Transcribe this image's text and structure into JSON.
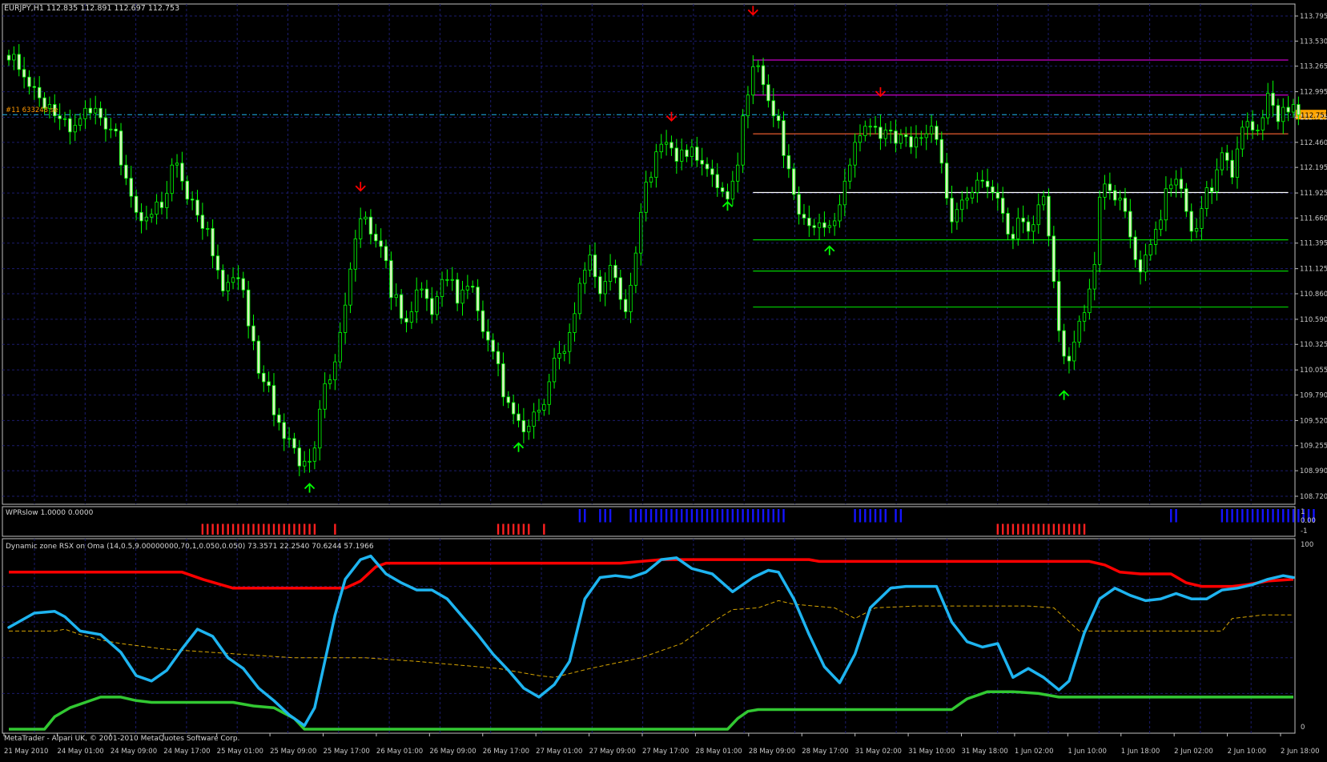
{
  "window": {
    "symbol_header": "EURJPY,H1  112.835 112.891 112.697 112.753",
    "order_label": "#11 633248 se",
    "footer": "MetaTrader - Alpari UK, © 2001-2010 MetaQuotes Software Corp."
  },
  "colors": {
    "background": "#000000",
    "grid": "#1c1c6e",
    "candle": "#00ff00",
    "candle_body_up": "#000000",
    "candle_body_down": "#d8f0c0",
    "price_tag_bg": "#ffa500",
    "signal_up": "#00ff00",
    "signal_down": "#ff0000",
    "rsx": "#1eb4f0",
    "upper_band": "#ff0000",
    "lower_band": "#32c832",
    "mid_band": "#d7a500",
    "wpr_up": "#1414ff",
    "wpr_down": "#ff2020"
  },
  "main": {
    "price_axis_labels": [
      "113.795",
      "113.530",
      "113.265",
      "112.995",
      "112.725",
      "112.460",
      "112.195",
      "111.925",
      "111.660",
      "111.395",
      "111.125",
      "110.860",
      "110.590",
      "110.325",
      "110.055",
      "109.790",
      "109.520",
      "109.255",
      "108.990",
      "108.720"
    ],
    "price_range": [
      108.72,
      113.795
    ],
    "current_price": "112.753",
    "horizontal_levels": [
      {
        "price": 113.33,
        "color": "#c800c8"
      },
      {
        "price": 112.96,
        "color": "#c800c8"
      },
      {
        "price": 112.55,
        "color": "#ff6432"
      },
      {
        "price": 111.93,
        "color": "#ffffff"
      },
      {
        "price": 111.43,
        "color": "#00d200"
      },
      {
        "price": 111.1,
        "color": "#00d200"
      },
      {
        "price": 110.72,
        "color": "#00d200"
      }
    ],
    "signals": [
      {
        "type": "down",
        "bar": 69,
        "price": 111.89
      },
      {
        "type": "down",
        "bar": 130,
        "price": 112.63
      },
      {
        "type": "down",
        "bar": 146,
        "price": 113.75
      },
      {
        "type": "down",
        "bar": 171,
        "price": 112.89
      },
      {
        "type": "up",
        "bar": 59,
        "price": 108.91
      },
      {
        "type": "up",
        "bar": 100,
        "price": 109.34
      },
      {
        "type": "up",
        "bar": 141,
        "price": 111.89
      },
      {
        "type": "up",
        "bar": 161,
        "price": 111.42
      },
      {
        "type": "up",
        "bar": 207,
        "price": 109.89
      }
    ]
  },
  "wpr": {
    "title": "WPRslow 1.0000 0.0000",
    "axis_labels": [
      "1",
      "0.00",
      "-1"
    ],
    "up_segments": [
      [
        112,
        113
      ],
      [
        116,
        118
      ],
      [
        122,
        152
      ],
      [
        166,
        172
      ],
      [
        174,
        175
      ],
      [
        228,
        229
      ],
      [
        238,
        256
      ]
    ],
    "down_segments": [
      [
        38,
        60
      ],
      [
        64,
        64
      ],
      [
        96,
        102
      ],
      [
        105,
        105
      ],
      [
        194,
        211
      ]
    ]
  },
  "rsx": {
    "title": "Dynamic zone RSX on Oma (14,0.5,9.00000000,70,1,0.050,0.050) 73.3571 22.2540 70.6244 57.1966",
    "axis_labels": [
      "100",
      "0"
    ],
    "blue_line": [
      [
        0,
        57
      ],
      [
        5,
        65
      ],
      [
        9,
        66
      ],
      [
        11,
        63
      ],
      [
        14,
        55
      ],
      [
        18,
        53
      ],
      [
        22,
        43
      ],
      [
        25,
        30
      ],
      [
        28,
        27
      ],
      [
        31,
        33
      ],
      [
        34,
        45
      ],
      [
        37,
        56
      ],
      [
        40,
        52
      ],
      [
        43,
        40
      ],
      [
        46,
        34
      ],
      [
        49,
        23
      ],
      [
        52,
        16
      ],
      [
        55,
        8
      ],
      [
        58,
        2
      ],
      [
        60,
        12
      ],
      [
        62,
        38
      ],
      [
        64,
        64
      ],
      [
        66,
        84
      ],
      [
        69,
        95
      ],
      [
        71,
        97
      ],
      [
        74,
        87
      ],
      [
        77,
        82
      ],
      [
        80,
        78
      ],
      [
        83,
        78
      ],
      [
        86,
        73
      ],
      [
        89,
        63
      ],
      [
        92,
        53
      ],
      [
        95,
        42
      ],
      [
        98,
        33
      ],
      [
        101,
        23
      ],
      [
        104,
        18
      ],
      [
        107,
        25
      ],
      [
        110,
        38
      ],
      [
        113,
        73
      ],
      [
        116,
        85
      ],
      [
        119,
        86
      ],
      [
        122,
        85
      ],
      [
        125,
        88
      ],
      [
        128,
        95
      ],
      [
        131,
        96
      ],
      [
        134,
        90
      ],
      [
        138,
        87
      ],
      [
        142,
        77
      ],
      [
        146,
        85
      ],
      [
        149,
        89
      ],
      [
        151,
        88
      ],
      [
        154,
        73
      ],
      [
        157,
        53
      ],
      [
        160,
        35
      ],
      [
        163,
        26
      ],
      [
        166,
        42
      ],
      [
        169,
        68
      ],
      [
        173,
        79
      ],
      [
        176,
        80
      ],
      [
        179,
        80
      ],
      [
        182,
        80
      ],
      [
        185,
        60
      ],
      [
        188,
        49
      ],
      [
        191,
        46
      ],
      [
        194,
        48
      ],
      [
        197,
        29
      ],
      [
        200,
        34
      ],
      [
        203,
        29
      ],
      [
        206,
        22
      ],
      [
        208,
        27
      ],
      [
        211,
        54
      ],
      [
        214,
        73
      ],
      [
        217,
        79
      ],
      [
        220,
        75
      ],
      [
        223,
        72
      ],
      [
        226,
        73
      ],
      [
        229,
        76
      ],
      [
        232,
        73
      ],
      [
        235,
        73
      ],
      [
        238,
        78
      ],
      [
        241,
        79
      ],
      [
        244,
        81
      ],
      [
        247,
        84
      ],
      [
        250,
        86
      ],
      [
        252,
        85
      ]
    ],
    "red_line": [
      [
        0,
        88
      ],
      [
        34,
        88
      ],
      [
        38,
        84
      ],
      [
        44,
        79
      ],
      [
        66,
        79
      ],
      [
        69,
        83
      ],
      [
        72,
        91
      ],
      [
        74,
        93
      ],
      [
        120,
        93
      ],
      [
        128,
        95
      ],
      [
        157,
        95
      ],
      [
        159,
        94
      ],
      [
        212,
        94
      ],
      [
        215,
        92
      ],
      [
        218,
        88
      ],
      [
        222,
        87
      ],
      [
        228,
        87
      ],
      [
        231,
        82
      ],
      [
        234,
        80
      ],
      [
        240,
        80
      ],
      [
        243,
        81
      ],
      [
        247,
        83
      ],
      [
        252,
        84
      ]
    ],
    "green_line": [
      [
        0,
        0
      ],
      [
        7,
        0
      ],
      [
        9,
        7
      ],
      [
        12,
        12
      ],
      [
        15,
        15
      ],
      [
        18,
        18
      ],
      [
        22,
        18
      ],
      [
        25,
        16
      ],
      [
        28,
        15
      ],
      [
        44,
        15
      ],
      [
        48,
        13
      ],
      [
        52,
        12
      ],
      [
        56,
        6
      ],
      [
        58,
        0
      ],
      [
        141,
        0
      ],
      [
        143,
        6
      ],
      [
        145,
        10
      ],
      [
        147,
        11
      ],
      [
        185,
        11
      ],
      [
        188,
        17
      ],
      [
        190,
        19
      ],
      [
        192,
        21
      ],
      [
        197,
        21
      ],
      [
        202,
        20
      ],
      [
        206,
        18
      ],
      [
        210,
        18
      ],
      [
        252,
        18
      ]
    ],
    "mid_line": [
      [
        0,
        55
      ],
      [
        9,
        55
      ],
      [
        11,
        56
      ],
      [
        14,
        53
      ],
      [
        18,
        50
      ],
      [
        22,
        48
      ],
      [
        30,
        45
      ],
      [
        40,
        43
      ],
      [
        56,
        40
      ],
      [
        70,
        40
      ],
      [
        80,
        38
      ],
      [
        96,
        34
      ],
      [
        104,
        30
      ],
      [
        107,
        29
      ],
      [
        114,
        34
      ],
      [
        124,
        40
      ],
      [
        132,
        48
      ],
      [
        138,
        60
      ],
      [
        142,
        67
      ],
      [
        147,
        68
      ],
      [
        151,
        72
      ],
      [
        154,
        70
      ],
      [
        162,
        68
      ],
      [
        166,
        62
      ],
      [
        170,
        68
      ],
      [
        178,
        69
      ],
      [
        190,
        69
      ],
      [
        200,
        69
      ],
      [
        205,
        68
      ],
      [
        210,
        55
      ],
      [
        225,
        55
      ],
      [
        238,
        55
      ],
      [
        240,
        62
      ],
      [
        246,
        64
      ],
      [
        252,
        64
      ]
    ]
  },
  "time_axis": {
    "labels": [
      "21 May 2010",
      "24 May 01:00",
      "24 May 09:00",
      "24 May 17:00",
      "25 May 01:00",
      "25 May 09:00",
      "25 May 17:00",
      "26 May 01:00",
      "26 May 09:00",
      "26 May 17:00",
      "27 May 01:00",
      "27 May 09:00",
      "27 May 17:00",
      "28 May 01:00",
      "28 May 09:00",
      "28 May 17:00",
      "31 May 02:00",
      "31 May 10:00",
      "31 May 18:00",
      "1 Jun 02:00",
      "1 Jun 10:00",
      "1 Jun 18:00",
      "2 Jun 02:00",
      "2 Jun 10:00",
      "2 Jun 18:00"
    ]
  },
  "chart_data": {
    "type": "candlestick",
    "symbol": "EURJPY",
    "timeframe": "H1",
    "bar_count": 253,
    "y_range": [
      108.72,
      113.795
    ],
    "close": [
      113.33,
      113.39,
      113.23,
      113.15,
      113.05,
      113.04,
      112.93,
      112.82,
      112.86,
      112.74,
      112.71,
      112.71,
      112.57,
      112.64,
      112.71,
      112.82,
      112.77,
      112.82,
      112.72,
      112.6,
      112.6,
      112.58,
      112.22,
      112.08,
      111.89,
      111.72,
      111.63,
      111.67,
      111.7,
      111.83,
      111.77,
      111.92,
      112.22,
      112.24,
      112.05,
      111.86,
      111.85,
      111.69,
      111.55,
      111.55,
      111.26,
      111.11,
      110.89,
      110.98,
      111.03,
      111.02,
      110.9,
      110.52,
      110.36,
      110.02,
      109.93,
      109.89,
      109.58,
      109.5,
      109.33,
      109.33,
      109.23,
      109.04,
      109.09,
      109.09,
      109.23,
      109.64,
      109.91,
      109.95,
      110.14,
      110.45,
      110.74,
      111.12,
      111.44,
      111.65,
      111.67,
      111.49,
      111.42,
      111.36,
      111.21,
      110.82,
      110.85,
      110.6,
      110.56,
      110.67,
      110.9,
      110.91,
      110.81,
      110.64,
      110.83,
      111.01,
      111.01,
      111.01,
      110.76,
      110.9,
      110.94,
      110.93,
      110.68,
      110.46,
      110.37,
      110.25,
      110.12,
      109.77,
      109.71,
      109.59,
      109.52,
      109.4,
      109.46,
      109.61,
      109.63,
      109.69,
      109.93,
      110.18,
      110.23,
      110.25,
      110.45,
      110.65,
      110.97,
      111.11,
      111.27,
      111.04,
      110.86,
      110.99,
      111.16,
      111.03,
      110.8,
      110.67,
      110.95,
      111.29,
      111.72,
      112.04,
      112.09,
      112.36,
      112.44,
      112.46,
      112.4,
      112.26,
      112.38,
      112.31,
      112.41,
      112.27,
      112.23,
      112.18,
      112.12,
      111.98,
      111.94,
      111.86,
      112.05,
      112.22,
      112.74,
      112.96,
      113.26,
      113.27,
      113.07,
      112.9,
      112.74,
      112.69,
      112.32,
      112.18,
      111.91,
      111.7,
      111.66,
      111.58,
      111.56,
      111.61,
      111.56,
      111.58,
      111.63,
      111.8,
      112.05,
      112.22,
      112.46,
      112.53,
      112.63,
      112.63,
      112.62,
      112.5,
      112.59,
      112.58,
      112.45,
      112.54,
      112.52,
      112.41,
      112.51,
      112.51,
      112.55,
      112.63,
      112.49,
      112.24,
      111.87,
      111.62,
      111.75,
      111.85,
      111.87,
      111.93,
      112.06,
      112.05,
      111.99,
      111.93,
      111.87,
      111.71,
      111.49,
      111.44,
      111.66,
      111.62,
      111.52,
      111.59,
      111.8,
      111.89,
      111.47,
      110.99,
      110.47,
      110.2,
      110.15,
      110.35,
      110.57,
      110.66,
      110.91,
      111.17,
      111.88,
      112.02,
      111.95,
      111.85,
      111.87,
      111.73,
      111.46,
      111.22,
      111.09,
      111.27,
      111.38,
      111.54,
      111.64,
      111.97,
      112.01,
      112.07,
      111.97,
      111.73,
      111.52,
      111.55,
      111.76,
      111.98,
      111.94,
      112.17,
      112.35,
      112.27,
      112.09,
      112.39,
      112.62,
      112.68,
      112.59,
      112.59,
      112.72,
      112.98,
      112.85,
      112.68,
      112.83,
      112.78,
      112.86,
      112.75
    ],
    "x_labels_ref": "time_axis.labels",
    "indicator_values": {
      "upper": 73.3571,
      "rsx": 22.254,
      "mid": 70.6244,
      "lower": 57.1966
    }
  }
}
